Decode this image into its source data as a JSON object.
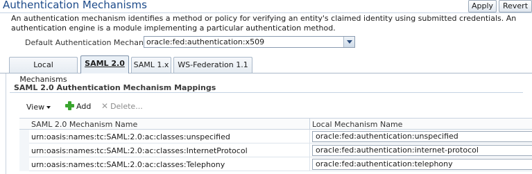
{
  "header": {
    "title": "Authentication Mechanisms",
    "apply_label": "Apply",
    "revert_label": "Revert",
    "description": "An authentication mechanism identifies a method or policy for verifying an entity's claimed identity using submitted credentials. An authentication engine is a module implementing a particular authentication method."
  },
  "default_mechanism": {
    "label": "Default Authentication Mechanism",
    "value": "oracle:fed:authentication:x509"
  },
  "tabs": [
    {
      "label": "Local Mechanisms",
      "selected": false
    },
    {
      "label": "SAML 2.0",
      "selected": true
    },
    {
      "label": "SAML 1.x",
      "selected": false
    },
    {
      "label": "WS-Federation 1.1",
      "selected": false
    }
  ],
  "section": {
    "title": "SAML 2.0 Authentication Mechanism Mappings"
  },
  "toolbar": {
    "view_label": "View",
    "add_label": "Add",
    "delete_label": "Delete..."
  },
  "table": {
    "columns": [
      "SAML 2.0 Mechanism Name",
      "Local Mechanism Name"
    ],
    "rows": [
      [
        "urn:oasis:names:tc:SAML:2.0:ac:classes:unspecified",
        "oracle:fed:authentication:unspecified"
      ],
      [
        "urn:oasis:names:tc:SAML:2.0:ac:classes:InternetProtocol",
        "oracle:fed:authentication:internet-protocol"
      ],
      [
        "urn:oasis:names:tc:SAML:2.0:ac:classes:Telephony",
        "oracle:fed:authentication:telephony"
      ]
    ]
  },
  "colors": {
    "title": "#1c4a8a",
    "add_icon": "#3aa52f",
    "tab_border": "#a9b8c9"
  }
}
